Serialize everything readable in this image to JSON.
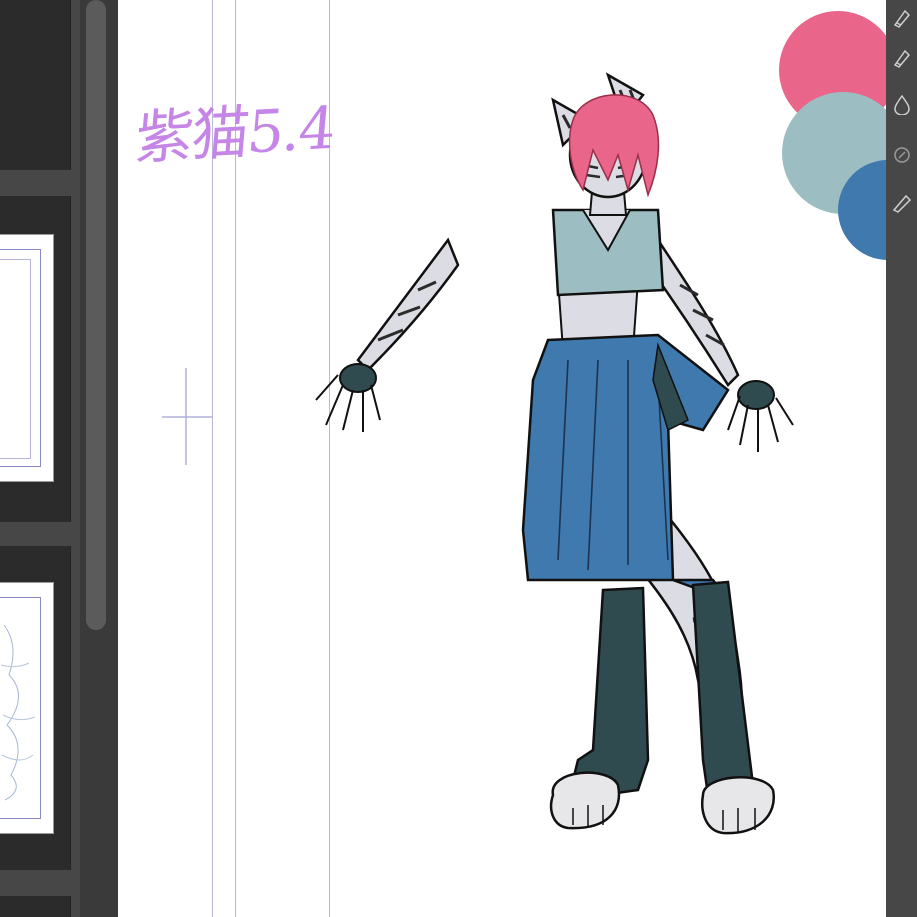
{
  "canvas": {
    "handwritten_note": "紫猫5.4",
    "palette": [
      "#e9658a",
      "#9cbdc1",
      "#3f79ae"
    ]
  },
  "colors": {
    "panel_bg": "#474747",
    "slot_bg": "#2b2b2b",
    "canvas_bg": "#ffffff",
    "guide_line": "#b9b9d6",
    "note_purple": "#c586e8",
    "hair_pink": "#e9658a",
    "top_teal": "#9cbdc1",
    "pants_blue": "#3f79ae",
    "boots_dark": "#2f4b4f",
    "fur_gray": "#dcdde4"
  },
  "tools": [
    "pen-nib-icon",
    "pen-nib-icon",
    "ink-drop-icon",
    "blend-brush-icon",
    "marker-pen-icon"
  ]
}
